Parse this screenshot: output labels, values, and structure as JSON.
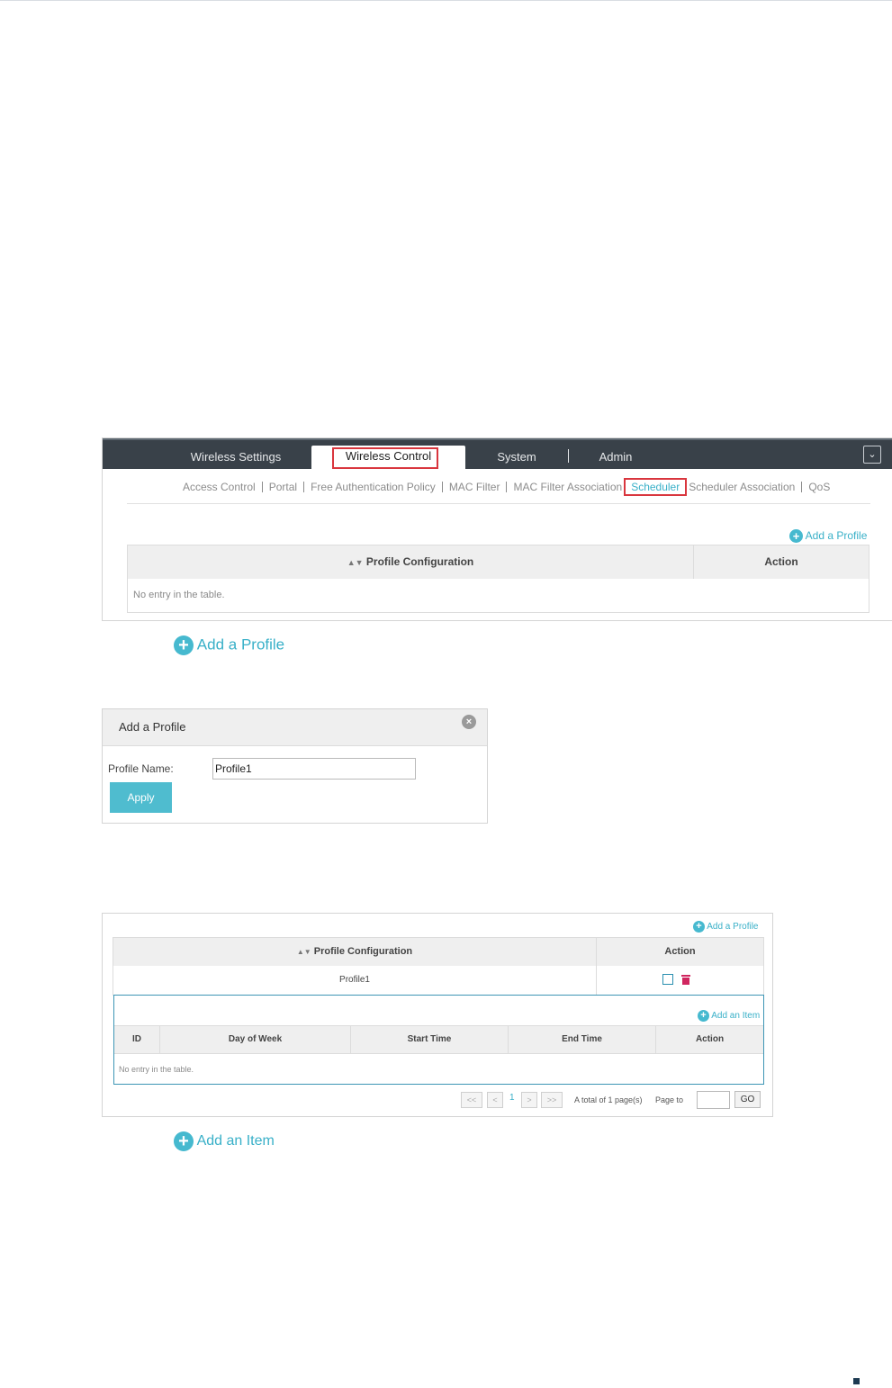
{
  "nav": {
    "tabs": [
      "Wireless Settings",
      "Wireless Control",
      "System",
      "Admin"
    ],
    "active_tab": "Wireless Control",
    "collapse_icon": "chevron-down-icon"
  },
  "subnav": {
    "items": [
      "Access Control",
      "Portal",
      "Free Authentication Policy",
      "MAC Filter",
      "MAC Filter Association",
      "Scheduler",
      "Scheduler Association",
      "QoS"
    ],
    "active": "Scheduler"
  },
  "profile_table": {
    "add_label": "Add a Profile",
    "columns": [
      "Profile Configuration",
      "Action"
    ],
    "empty_text": "No entry in the table."
  },
  "callout_add_profile": "Add a Profile",
  "dialog": {
    "title": "Add a Profile",
    "field_label": "Profile Name:",
    "field_value": "Profile1",
    "apply_label": "Apply"
  },
  "profile_table2": {
    "add_label": "Add a Profile",
    "columns": [
      "Profile Configuration",
      "Action"
    ],
    "row": "Profile1",
    "inner": {
      "add_label": "Add an Item",
      "columns": [
        "ID",
        "Day of Week",
        "Start Time",
        "End Time",
        "Action"
      ],
      "empty_text": "No entry in the table."
    },
    "pagination": {
      "first": "<<",
      "prev": "<",
      "current": "1",
      "next": ">",
      "last": ">>",
      "total": "A total of 1 page(s)",
      "page_to": "Page to",
      "go": "GO"
    }
  },
  "callout_add_item": "Add an Item",
  "colors": {
    "accent": "#39b0c8",
    "highlight": "#d9363e",
    "navbar": "#394149"
  }
}
